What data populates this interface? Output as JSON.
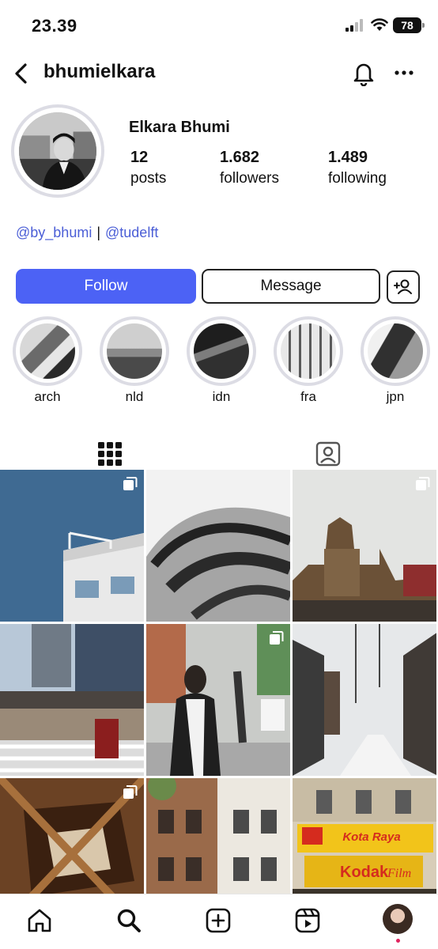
{
  "status_bar": {
    "time": "23.39",
    "battery": "78"
  },
  "header": {
    "username": "bhumielkara"
  },
  "profile": {
    "display_name": "Elkara Bhumi",
    "stats": [
      {
        "value": "12",
        "label": "posts"
      },
      {
        "value": "1.682",
        "label": "followers"
      },
      {
        "value": "1.489",
        "label": "following"
      }
    ],
    "bio_links": [
      "@by_bhumi",
      "@tudelft"
    ],
    "bio_separator": "|"
  },
  "actions": {
    "follow_label": "Follow",
    "message_label": "Message"
  },
  "highlights": [
    {
      "label": "arch"
    },
    {
      "label": "nld"
    },
    {
      "label": "idn"
    },
    {
      "label": "fra"
    },
    {
      "label": "jpn"
    }
  ],
  "tabs": [
    {
      "icon": "grid-icon",
      "active": true
    },
    {
      "icon": "tagged-icon",
      "active": false
    }
  ],
  "bottom_nav": [
    {
      "icon": "home-icon"
    },
    {
      "icon": "search-icon"
    },
    {
      "icon": "create-icon"
    },
    {
      "icon": "reels-icon"
    },
    {
      "icon": "profile-avatar"
    }
  ],
  "colors": {
    "accent": "#4c62f5",
    "link": "#4b5ed6",
    "ring": "#dcdce4"
  },
  "posts": [
    {
      "multi": true,
      "banner": ""
    },
    {
      "multi": false,
      "banner": ""
    },
    {
      "multi": true,
      "banner": ""
    },
    {
      "multi": false,
      "banner": ""
    },
    {
      "multi": true,
      "banner": ""
    },
    {
      "multi": false,
      "banner": ""
    },
    {
      "multi": true,
      "banner": ""
    },
    {
      "multi": false,
      "banner": ""
    },
    {
      "multi": false,
      "banner": "Kota Raya"
    }
  ],
  "kodak": {
    "brand": "Kodak",
    "film": "Film"
  }
}
